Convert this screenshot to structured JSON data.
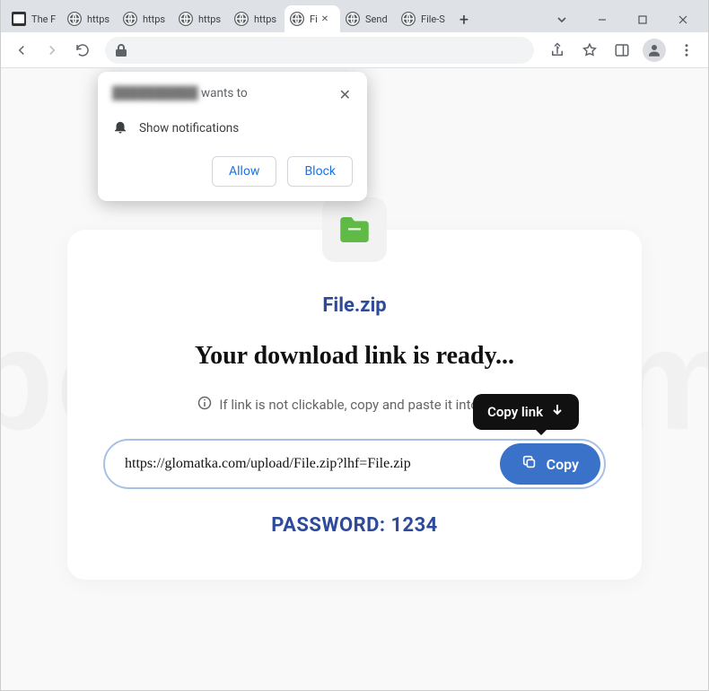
{
  "tabs": [
    {
      "label": "The F"
    },
    {
      "label": "https"
    },
    {
      "label": "https"
    },
    {
      "label": "https"
    },
    {
      "label": "https"
    },
    {
      "label": "Fi"
    },
    {
      "label": "Send"
    },
    {
      "label": "File-S"
    }
  ],
  "perm": {
    "origin_blurred": "██████████",
    "wants_to": " wants to",
    "noti_label": "Show notifications",
    "allow": "Allow",
    "block": "Block"
  },
  "card": {
    "filename": "File.zip",
    "headline": "Your download link is ready...",
    "hint": "If link is not clickable, copy and paste it into the a",
    "link": "https://glomatka.com/upload/File.zip?lhf=File.zip",
    "copy_label": "Copy",
    "tooltip_label": "Copy link",
    "password_label": "PASSWORD: 1234"
  },
  "watermark": "pcrisk.com"
}
